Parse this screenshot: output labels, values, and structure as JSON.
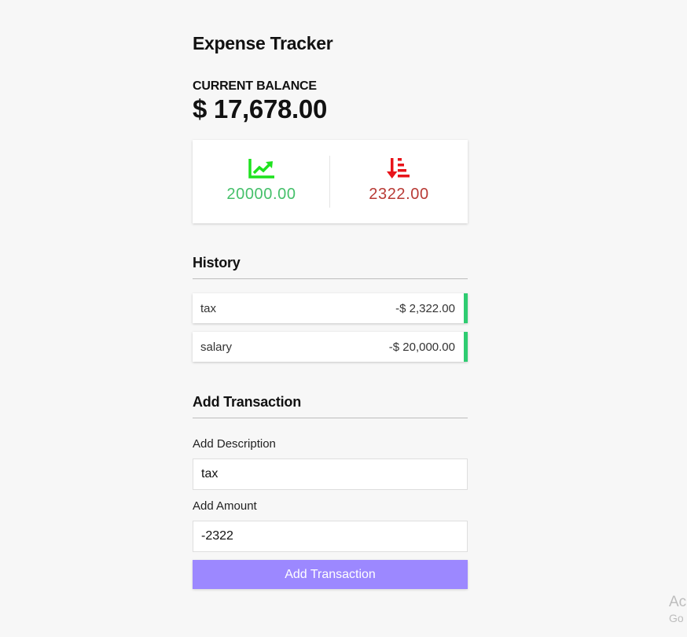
{
  "app": {
    "title": "Expense Tracker"
  },
  "balance": {
    "label": "CURRENT BALANCE",
    "value": "$ 17,678.00"
  },
  "summary": {
    "income": {
      "amount": "20000.00",
      "icon": "chart-line-up-icon",
      "color": "#45c06a"
    },
    "expense": {
      "amount": "2322.00",
      "icon": "sort-amount-down-icon",
      "color": "#b83a35"
    }
  },
  "history": {
    "title": "History",
    "items": [
      {
        "description": "tax",
        "amount": "-$ 2,322.00",
        "indicator_color": "#2ecc71"
      },
      {
        "description": "salary",
        "amount": "-$ 20,000.00",
        "indicator_color": "#2ecc71"
      }
    ]
  },
  "form": {
    "title": "Add Transaction",
    "description_label": "Add Description",
    "description_value": "tax",
    "amount_label": "Add Amount",
    "amount_value": "-2322",
    "submit_label": "Add Transaction",
    "submit_color": "#9c88ff"
  },
  "watermark": {
    "line1": "Ac",
    "line2": "Go"
  }
}
